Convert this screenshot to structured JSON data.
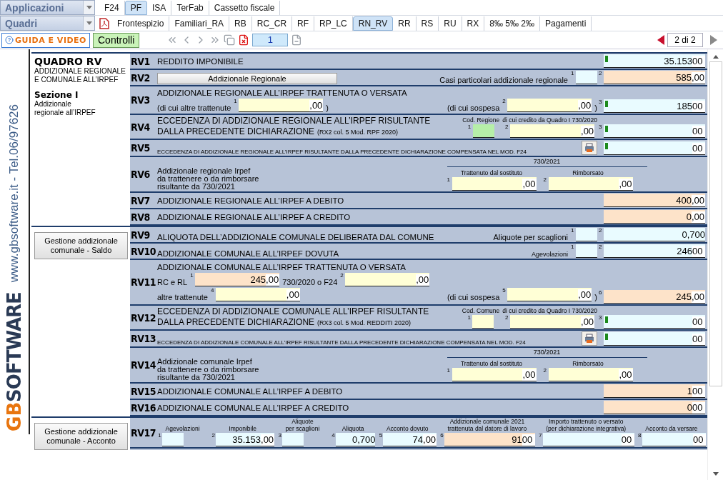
{
  "toolbar": {
    "app_menu": {
      "label": "Applicazioni"
    },
    "app_tabs": [
      {
        "label": "F24",
        "selected": false
      },
      {
        "label": "PF",
        "selected": true
      },
      {
        "label": "ISA",
        "selected": false
      },
      {
        "label": "TerFab",
        "selected": false
      },
      {
        "label": "Cassetto fiscale",
        "selected": false
      }
    ],
    "quadri_menu": {
      "label": "Quadri"
    },
    "quadri_tabs": [
      {
        "label": "Frontespizio",
        "selected": false
      },
      {
        "label": "Familiari_RA",
        "selected": false
      },
      {
        "label": "RB",
        "selected": false
      },
      {
        "label": "RC_CR",
        "selected": false
      },
      {
        "label": "RF",
        "selected": false
      },
      {
        "label": "RP_LC",
        "selected": false
      },
      {
        "label": "RN_RV",
        "selected": true
      },
      {
        "label": "RR",
        "selected": false
      },
      {
        "label": "RS",
        "selected": false
      },
      {
        "label": "RU",
        "selected": false
      },
      {
        "label": "RX",
        "selected": false
      },
      {
        "label": "8‰ 5‰ 2‰",
        "selected": false
      },
      {
        "label": "Pagamenti",
        "selected": false
      }
    ],
    "guide_button": "GUIDA E VIDEO",
    "check_button": "Controlli",
    "page": "1",
    "page_count": "2 di 2"
  },
  "brand": {
    "website": "www.gbsoftware.it - Tel.06/97626",
    "logo_mark": "GB",
    "logo_word": "SOFTWARE"
  },
  "sections": [
    {
      "side": {
        "kind": "intro",
        "title": "QUADRO RV",
        "subtitle": [
          "ADDIZIONALE REGIONALE",
          "E COMUNALE ALL’IRPEF"
        ],
        "section": "Sezione I",
        "section_note": [
          "Addizionale",
          "regionale all’IRPEF"
        ]
      },
      "rows": [
        {
          "code": "RV1",
          "lines": [
            [
              [
                {
                  "kind": "label",
                  "text": "REDDITO IMPONIBILE"
                }
              ]
            ]
          ],
          "total": {
            "value": "35.153",
            "cents": "00",
            "color": "#e9fbff",
            "flag": true
          }
        },
        {
          "code": "RV2",
          "lines": [
            [
              [
                {
                  "kind": "button",
                  "text": "Addizionale Regionale"
                }
              ],
              [
                {
                  "kind": "note",
                  "text": "Casi particolari addizionale regionale"
                },
                {
                  "kind": "code",
                  "num": "1",
                  "color": "#e9fbff"
                }
              ]
            ]
          ],
          "total": {
            "num": "2",
            "value": "585",
            "cents": ",00",
            "color": "#fde3c9",
            "flag": false
          }
        },
        {
          "code": "RV3",
          "lines": [
            [
              [
                {
                  "kind": "label",
                  "text": "ADDIZIONALE REGIONALE ALL’IRPEF TRATTENUTA O VERSATA"
                }
              ]
            ],
            [
              [
                {
                  "kind": "note",
                  "text": "(di cui altre trattenute"
                },
                {
                  "kind": "field",
                  "num": "1",
                  "cents": ",00",
                  "color": "#ffffd6"
                },
                {
                  "kind": "note",
                  "text": ")"
                }
              ],
              [
                {
                  "kind": "note",
                  "text": "(di cui sospesa"
                },
                {
                  "kind": "field",
                  "num": "2",
                  "cents": ",00",
                  "color": "#ffffd6"
                },
                {
                  "kind": "note",
                  "text": ")"
                }
              ]
            ]
          ],
          "total": {
            "num": "3",
            "value": "185",
            "cents": "00",
            "color": "#e9fbff",
            "flag": true
          }
        },
        {
          "code": "RV4",
          "lines": [
            [
              [
                {
                  "kind": "block",
                  "lines": [
                    {
                      "text": "ECCEDENZA DI ADDIZIONALE REGIONALE ALL’IRPEF RISULTANTE"
                    },
                    {
                      "text": "DALLA PRECEDENTE DICHIARAZIONE",
                      "note": "(RX2 col. 5 Mod. RPF 2020)"
                    }
                  ]
                }
              ],
              [
                {
                  "kind": "stack",
                  "caption": [
                    "Cod. Regione"
                  ],
                  "field": {
                    "kind": "code",
                    "num": "1",
                    "color": "#b6efa8"
                  }
                },
                {
                  "kind": "stack",
                  "caption": [
                    "di cui credito da Quadro I 730/2020"
                  ],
                  "field": {
                    "kind": "field",
                    "num": "2",
                    "cents": ",00",
                    "color": "#ffffd6"
                  }
                }
              ]
            ]
          ],
          "total": {
            "num": "3",
            "cents": "00",
            "color": "#e9fbff",
            "flag": true
          }
        },
        {
          "code": "RV5",
          "lines": [
            [
              [
                {
                  "kind": "fine",
                  "text": "ECCEDENZA DI ADDIZIONALE REGIONALE  ALL’IRPEF RISULTANTE DALLA PRECEDENTE DICHIARAZIONE COMPENSATA NEL MOD. F24"
                }
              ],
              [
                {
                  "kind": "f24"
                }
              ]
            ]
          ],
          "total": {
            "cents": "00",
            "color": "#e9fbff",
            "flag": true
          }
        },
        {
          "code": "RV6",
          "lines": [
            [
              [
                {
                  "kind": "block",
                  "small": true,
                  "lines": [
                    {
                      "text": "Addizionale regionale Irpef"
                    },
                    {
                      "text": "da trattenere o da rimborsare"
                    },
                    {
                      "text": "risultante da 730/2021"
                    }
                  ]
                }
              ],
              [
                {
                  "kind": "split",
                  "title": "730/2021",
                  "parts": [
                    {
                      "caption": [
                        "Trattenuto dal sostituto"
                      ],
                      "field": {
                        "kind": "field",
                        "num": "1",
                        "cents": ",00",
                        "color": "#ffffd6"
                      }
                    },
                    {
                      "caption": [
                        "Rimborsato"
                      ],
                      "field": {
                        "kind": "field",
                        "num": "2",
                        "cents": ",00",
                        "color": "#ffffd6"
                      }
                    }
                  ]
                }
              ]
            ]
          ]
        },
        {
          "code": "RV7",
          "lines": [
            [
              [
                {
                  "kind": "label",
                  "text": "ADDIZIONALE REGIONALE ALL’IRPEF A DEBITO"
                }
              ]
            ]
          ],
          "total": {
            "value": "400",
            "cents": ",00",
            "color": "#fde3c9",
            "flag": false
          }
        },
        {
          "code": "RV8",
          "lines": [
            [
              [
                {
                  "kind": "label",
                  "text": "ADDIZIONALE REGIONALE ALL’IRPEF A CREDITO"
                }
              ]
            ]
          ],
          "total": {
            "value": "0",
            "cents": ",00",
            "color": "#fde3c9",
            "flag": false
          }
        }
      ]
    },
    {
      "side": {
        "kind": "button",
        "lines": [
          "Gestione addizionale",
          "comunale - Saldo"
        ]
      },
      "rows": [
        {
          "code": "RV9",
          "lines": [
            [
              [
                {
                  "kind": "label",
                  "text": "ALIQUOTA DELL’ADDIZIONALE COMUNALE DELIBERATA DAL COMUNE"
                }
              ],
              [
                {
                  "kind": "note",
                  "text": "Aliquote per scaglioni"
                },
                {
                  "kind": "code",
                  "num": "1",
                  "color": "#e9fbff"
                }
              ]
            ]
          ],
          "total": {
            "num": "2",
            "value": "0,700",
            "color": "#e9fbff",
            "flag": false
          }
        },
        {
          "code": "RV10",
          "lines": [
            [
              [
                {
                  "kind": "label",
                  "text": "ADDIZIONALE COMUNALE ALL’IRPEF DOVUTA"
                }
              ],
              [
                {
                  "kind": "small",
                  "text": "Agevolazioni"
                },
                {
                  "kind": "code",
                  "num": "1",
                  "color": "#e9fbff"
                }
              ]
            ]
          ],
          "total": {
            "num": "2",
            "value": "246",
            "cents": "00",
            "color": "#e9fbff",
            "flag": false
          }
        },
        {
          "code": "RV11",
          "lines": [
            [
              [
                {
                  "kind": "label",
                  "text": "ADDIZIONALE COMUNALE ALL’IRPEF TRATTENUTA O VERSATA"
                }
              ]
            ],
            [
              [
                {
                  "kind": "note",
                  "text": "RC e RL"
                },
                {
                  "kind": "field",
                  "num": "1",
                  "value": "245",
                  "cents": ",00",
                  "color": "#fde3c9"
                },
                {
                  "kind": "note",
                  "text": "730/2020 o F24"
                },
                {
                  "kind": "field",
                  "num": "2",
                  "cents": ",00",
                  "color": "#ffffd6"
                }
              ]
            ],
            [
              [
                {
                  "kind": "note",
                  "text": "altre trattenute"
                },
                {
                  "kind": "field",
                  "num": "4",
                  "cents": ",00",
                  "color": "#ffffd6"
                }
              ],
              [
                {
                  "kind": "note",
                  "text": "(di cui sospesa"
                },
                {
                  "kind": "field",
                  "num": "5",
                  "cents": ",00",
                  "color": "#ffffd6"
                },
                {
                  "kind": "note",
                  "text": ")"
                }
              ]
            ]
          ],
          "total": {
            "num": "6",
            "value": "245",
            "cents": ",00",
            "color": "#fde3c9",
            "flag": false
          }
        },
        {
          "code": "RV12",
          "lines": [
            [
              [
                {
                  "kind": "block",
                  "lines": [
                    {
                      "text": "ECCEDENZA DI ADDIZIONALE COMUNALE ALL’IRPEF RISULTANTE"
                    },
                    {
                      "text": "DALLA PRECEDENTE DICHIARAZIONE",
                      "note": "(RX3 col. 5 Mod. REDDITI 2020)"
                    }
                  ]
                }
              ],
              [
                {
                  "kind": "stack",
                  "caption": [
                    "Cod. Comune"
                  ],
                  "field": {
                    "kind": "code",
                    "num": "1",
                    "color": "#ffffd6"
                  }
                },
                {
                  "kind": "stack",
                  "caption": [
                    "di cui credito da Quadro I 730/2020"
                  ],
                  "field": {
                    "kind": "field",
                    "num": "2",
                    "cents": ",00",
                    "color": "#ffffd6"
                  }
                }
              ]
            ]
          ],
          "total": {
            "num": "3",
            "cents": "00",
            "color": "#e9fbff",
            "flag": true
          }
        },
        {
          "code": "RV13",
          "lines": [
            [
              [
                {
                  "kind": "fine",
                  "text": "ECCEDENZA DI ADDIZIONALE COMUNALE ALL’IRPEF RISULTANTE DALLA PRECEDENTE DICHIARAZIONE COMPENSATA NEL MOD. F24"
                }
              ],
              [
                {
                  "kind": "f24"
                }
              ]
            ]
          ],
          "total": {
            "cents": "00",
            "color": "#e9fbff",
            "flag": true
          }
        },
        {
          "code": "RV14",
          "lines": [
            [
              [
                {
                  "kind": "block",
                  "small": true,
                  "lines": [
                    {
                      "text": "Addizionale comunale Irpef"
                    },
                    {
                      "text": "da trattenere o da rimborsare"
                    },
                    {
                      "text": "risultante da 730/2021"
                    }
                  ]
                }
              ],
              [
                {
                  "kind": "split",
                  "title": "730/2021",
                  "parts": [
                    {
                      "caption": [
                        "Trattenuto dal sostituto"
                      ],
                      "field": {
                        "kind": "field",
                        "num": "1",
                        "cents": ",00",
                        "color": "#ffffd6"
                      }
                    },
                    {
                      "caption": [
                        "Rimborsato"
                      ],
                      "field": {
                        "kind": "field",
                        "num": "2",
                        "cents": ",00",
                        "color": "#ffffd6"
                      }
                    }
                  ]
                }
              ]
            ]
          ]
        },
        {
          "code": "RV15",
          "lines": [
            [
              [
                {
                  "kind": "label",
                  "text": "ADDIZIONALE COMUNALE ALL’IRPEF A DEBITO"
                }
              ]
            ]
          ],
          "total": {
            "value": "1",
            "cents": "00",
            "color": "#fde3c9",
            "flag": false
          }
        },
        {
          "code": "RV16",
          "lines": [
            [
              [
                {
                  "kind": "label",
                  "text": "ADDIZIONALE COMUNALE ALL’IRPEF A CREDITO"
                }
              ]
            ]
          ],
          "total": {
            "value": "0",
            "cents": "00",
            "color": "#fde3c9",
            "flag": false
          }
        }
      ]
    },
    {
      "side": {
        "kind": "button",
        "lines": [
          "Gestione addizionale",
          "comunale - Acconto"
        ]
      },
      "rows": [
        {
          "code": "RV17",
          "lines": [
            [
              [
                {
                  "kind": "stack",
                  "caption": [
                    "Agevolazioni"
                  ],
                  "field": {
                    "kind": "code",
                    "num": "1",
                    "color": "#e9fbff"
                  }
                },
                {
                  "kind": "stack",
                  "caption": [
                    "Imponibile"
                  ],
                  "field": {
                    "kind": "field",
                    "num": "2",
                    "value": "35.153",
                    "cents": ",00",
                    "color": "#e9fbff"
                  }
                },
                {
                  "kind": "stack",
                  "caption": [
                    "Aliquote",
                    "per scaglioni"
                  ],
                  "field": {
                    "kind": "code",
                    "num": "3",
                    "color": "#e9fbff"
                  }
                },
                {
                  "kind": "stack",
                  "caption": [
                    "Aliquota"
                  ],
                  "field": {
                    "kind": "field",
                    "num": "4",
                    "value": "0,700",
                    "color": "#e9fbff"
                  }
                },
                {
                  "kind": "stack",
                  "caption": [
                    "Acconto dovuto"
                  ],
                  "field": {
                    "kind": "field",
                    "num": "5",
                    "value": "74",
                    "cents": ",00",
                    "color": "#e9fbff"
                  }
                },
                {
                  "kind": "stack",
                  "caption": [
                    "Addizionale comunale 2021",
                    "trattenuta dal datore di lavoro"
                  ],
                  "field": {
                    "kind": "field",
                    "num": "6",
                    "value": "91",
                    "cents": "00",
                    "color": "#fde3c9"
                  }
                },
                {
                  "kind": "stack",
                  "caption": [
                    "Importo trattenuto o versato",
                    "(per dichiarazione integrativa)"
                  ],
                  "field": {
                    "kind": "field",
                    "num": "7",
                    "cents": "00",
                    "color": "#e9fbff"
                  }
                },
                {
                  "kind": "stack",
                  "caption": [
                    "Acconto da versare"
                  ],
                  "field": {
                    "kind": "field",
                    "num": "8",
                    "cents": "00",
                    "color": "#e9fbff"
                  }
                }
              ]
            ]
          ]
        }
      ]
    }
  ]
}
